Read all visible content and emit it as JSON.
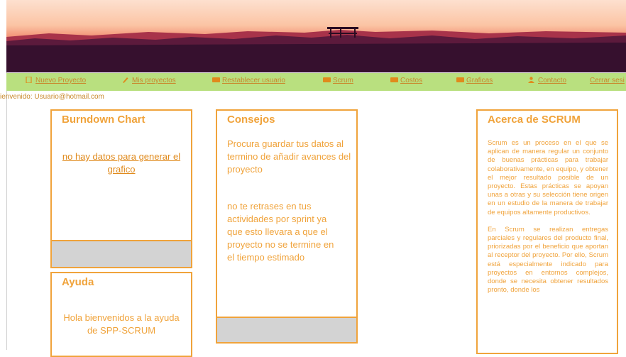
{
  "colors": {
    "accent": "#f0a33b",
    "nav_bg": "#b9e07f",
    "footer_gray": "#d3d3d3"
  },
  "nav": {
    "items": [
      {
        "label": "Nuevo Proyecto",
        "icon": "document-icon"
      },
      {
        "label": "Mis proyectos",
        "icon": "pencil-icon"
      },
      {
        "label": "Restablecer usuario",
        "icon": "user-reset-icon"
      },
      {
        "label": "Scrum",
        "icon": "card-icon"
      },
      {
        "label": "Costos",
        "icon": "card-icon"
      },
      {
        "label": "Graficas",
        "icon": "card-icon"
      },
      {
        "label": "Contacto",
        "icon": "person-icon"
      },
      {
        "label": "Cerrar sesi",
        "icon": ""
      }
    ]
  },
  "welcome": "ienvenido: Usuario@hotmail.com",
  "burndown": {
    "title": "Burndown Chart",
    "message": "no hay datos para generar el grafico"
  },
  "consejos": {
    "title": "Consejos",
    "tip1": "Procura guardar tus datos al termino de añadir avances del proyecto",
    "tip2": "no te retrases en tus actividades por sprint ya que esto llevara a que el proyecto no se termine en el tiempo estimado"
  },
  "ayuda": {
    "title": "Ayuda",
    "message": "Hola bienvenidos a la ayuda de SPP-SCRUM"
  },
  "about": {
    "title": "Acerca de SCRUM",
    "p1": "Scrum es un proceso en el que se aplican de manera regular un conjunto de buenas prácticas para trabajar colaborativamente, en equipo, y obtener el mejor resultado posible de un proyecto. Estas prácticas se apoyan unas a otras y su selección tiene origen en un estudio de la manera de trabajar de equipos altamente productivos.",
    "p2": "En Scrum se realizan entregas parciales y regulares del producto final, priorizadas por el beneficio que aportan al receptor del proyecto. Por ello, Scrum está especialmente indicado para proyectos en entornos complejos, donde se necesita obtener resultados pronto, donde los"
  }
}
